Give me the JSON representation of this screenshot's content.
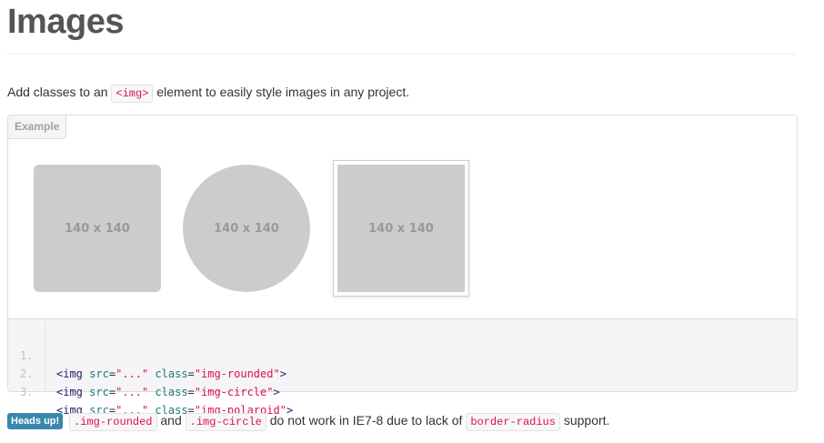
{
  "header": {
    "title": "Images"
  },
  "intro": {
    "before": "Add classes to an ",
    "code": "<img>",
    "after": " element to easily style images in any project."
  },
  "example": {
    "label": "Example",
    "images": [
      {
        "text": "140 x 140",
        "style": "rounded"
      },
      {
        "text": "140 x 140",
        "style": "circle"
      },
      {
        "text": "140 x 140",
        "style": "polaroid"
      }
    ]
  },
  "code_sample": {
    "lines": [
      {
        "num": "1.",
        "tag": "<img",
        "attr1": "src",
        "val1": "\"...\"",
        "attr2": "class",
        "val2": "\"img-rounded\"",
        "close": ">"
      },
      {
        "num": "2.",
        "tag": "<img",
        "attr1": "src",
        "val1": "\"...\"",
        "attr2": "class",
        "val2": "\"img-circle\"",
        "close": ">"
      },
      {
        "num": "3.",
        "tag": "<img",
        "attr1": "src",
        "val1": "\"...\"",
        "attr2": "class",
        "val2": "\"img-polaroid\"",
        "close": ">"
      }
    ]
  },
  "note": {
    "badge": "Heads up!",
    "code1": ".img-rounded",
    "and": " and ",
    "code2": ".img-circle",
    "middle": " do not work in IE7-8 due to lack of ",
    "code3": "border-radius",
    "end": " support."
  },
  "colors": {
    "placeholder": "#cccccc",
    "badge": "#3a87ad",
    "code_text": "#dd1144"
  }
}
